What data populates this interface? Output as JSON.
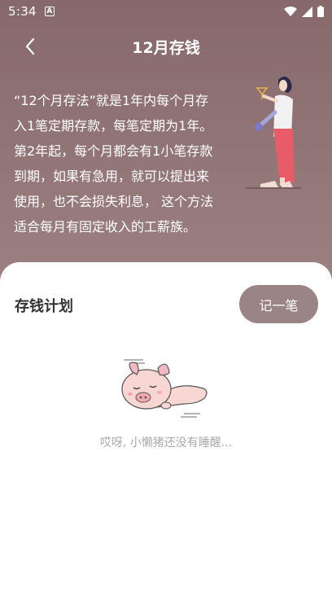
{
  "status_bar": {
    "time": "5:34",
    "notification_icon": "A"
  },
  "nav": {
    "title": "12月存钱",
    "back_icon": "chevron-left-icon"
  },
  "intro": {
    "text": "“12个月存法”就是1年内每个月存入1笔定期存款，每笔定期为1年。第2年起，每个月都会有1小笔存款到期，如果有急用，就可以提出来使用，也不会损失利息， 这个方法适合每月有固定收入的工薪族。"
  },
  "plan": {
    "title": "存钱计划",
    "record_button": "记一笔",
    "empty_text": "哎呀, 小懒猪还没有睡醒..."
  },
  "colors": {
    "background_top": "#87696b",
    "background_bottom": "#a98f90",
    "button": "#9a8485",
    "pig": "#f7d6d3"
  }
}
